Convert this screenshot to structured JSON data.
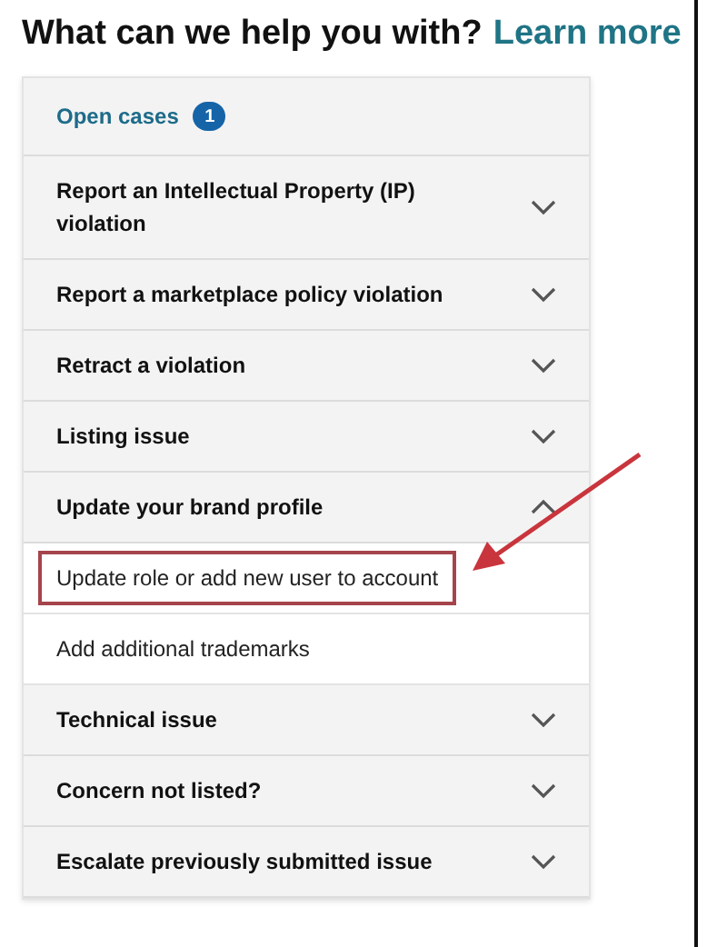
{
  "heading": {
    "text": "What can we help you with?",
    "link": "Learn more"
  },
  "open_cases": {
    "label": "Open cases",
    "count": "1"
  },
  "topics": [
    {
      "label": "Report an Intellectual Property (IP) violation",
      "expanded": false
    },
    {
      "label": "Report a marketplace policy violation",
      "expanded": false
    },
    {
      "label": "Retract a violation",
      "expanded": false
    },
    {
      "label": "Listing issue",
      "expanded": false
    },
    {
      "label": "Update your brand profile",
      "expanded": true,
      "children": [
        {
          "label": "Update role or add new user to account",
          "highlighted": true
        },
        {
          "label": "Add additional trademarks",
          "highlighted": false
        }
      ]
    },
    {
      "label": "Technical issue",
      "expanded": false
    },
    {
      "label": "Concern not listed?",
      "expanded": false
    },
    {
      "label": "Escalate previously submitted issue",
      "expanded": false
    }
  ]
}
